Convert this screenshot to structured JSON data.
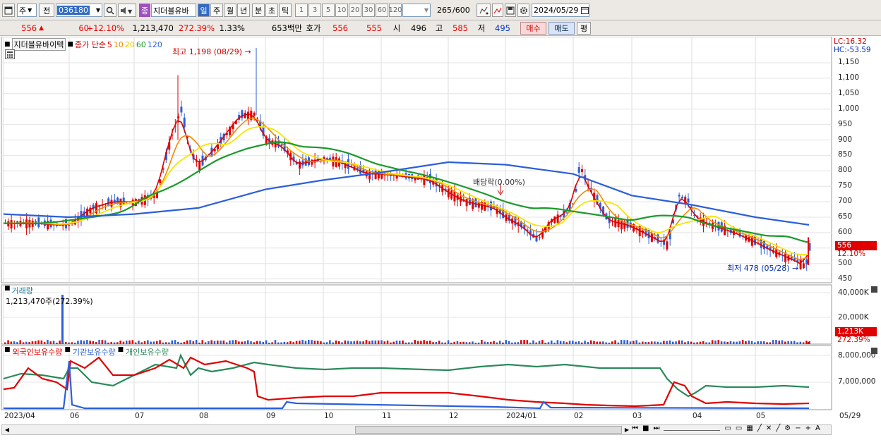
{
  "toolbar": {
    "type_select": "주",
    "prev_label": "전",
    "code": "036180",
    "name_badge": "종",
    "name": "지더블유바",
    "period_day": "일",
    "period_week": "주",
    "period_month": "월",
    "period_year": "년",
    "period_min": "분",
    "period_sec": "초",
    "period_tick": "틱",
    "intervals": [
      "1",
      "3",
      "5",
      "10",
      "20",
      "30",
      "60",
      "120"
    ],
    "count": "265",
    "count_total": "/600",
    "date": "2024/05/29"
  },
  "quote": {
    "price": "556",
    "change_arrow": "▲",
    "change": "60",
    "change_pct": "+12.10%",
    "volume": "1,213,470",
    "volume_pct": "272.39%",
    "turnover": "1.33%",
    "amount": "653백만",
    "bid_ask_label": "호가",
    "ask": "556",
    "bid": "555",
    "open_label": "시",
    "open": "496",
    "high_label": "고",
    "high": "585",
    "low_label": "저",
    "low": "495",
    "buy_label": "매수",
    "sell_label": "매도",
    "eval_label": "평"
  },
  "price_chart": {
    "title_tab": "지더블유바이텍",
    "ma_label": "종가 단순",
    "ma_periods": [
      "5",
      "10",
      "20",
      "60",
      "120"
    ],
    "ma_colors": [
      "#e00000",
      "#f08a00",
      "#f5e600",
      "#1a9a2a",
      "#2b5fd9"
    ],
    "high_note": "최고 1,198 (08/29)",
    "low_note": "최저 478 (05/28)",
    "dividend_note": "배당락(0.00%)",
    "lc": "LC:16.32",
    "hc": "HC:-53.59",
    "price_ticks": [
      "1,150",
      "1,100",
      "1,050",
      "1,000",
      "950",
      "900",
      "850",
      "800",
      "750",
      "700",
      "650",
      "600",
      "550",
      "500",
      "450"
    ],
    "current_price_tag": "556",
    "current_pct_tag": "12.10%"
  },
  "volume_chart": {
    "title": "거래량",
    "value": "1,213,470주(272.39%)",
    "ticks": [
      "40,000K",
      "20,000K"
    ],
    "current_tag": "1,213K",
    "current_pct_tag": "272.39%"
  },
  "holder_chart": {
    "series_labels": [
      "외국인보유수량",
      "기관보유수량",
      "개인보유수량"
    ],
    "series_colors": [
      "#e00000",
      "#2b5fd9",
      "#2a8a5a"
    ],
    "ticks": [
      "8,000,000",
      "7,000,000"
    ]
  },
  "x_axis": {
    "labels": [
      "2023/04",
      "06",
      "07",
      "08",
      "09",
      "10",
      "11",
      "12",
      "2024/01",
      "02",
      "03",
      "04",
      "05",
      "05/29"
    ]
  },
  "chart_data": {
    "type": "line",
    "x": [
      "2023-04",
      "2023-05",
      "2023-06",
      "2023-07",
      "2023-08",
      "2023-08-29",
      "2023-09",
      "2023-10",
      "2023-11",
      "2023-12",
      "2024-01",
      "2024-02",
      "2024-03",
      "2024-04",
      "2024-05",
      "2024-05-28",
      "2024-05-29"
    ],
    "series": [
      {
        "name": "5",
        "values": [
          630,
          625,
          660,
          720,
          960,
          1000,
          880,
          820,
          780,
          790,
          700,
          820,
          620,
          660,
          560,
          500,
          556
        ]
      },
      {
        "name": "120",
        "values": [
          660,
          650,
          660,
          680,
          720,
          740,
          760,
          790,
          800,
          830,
          800,
          780,
          720,
          680,
          640,
          630,
          625
        ]
      }
    ],
    "ylim": [
      450,
      1200
    ]
  }
}
